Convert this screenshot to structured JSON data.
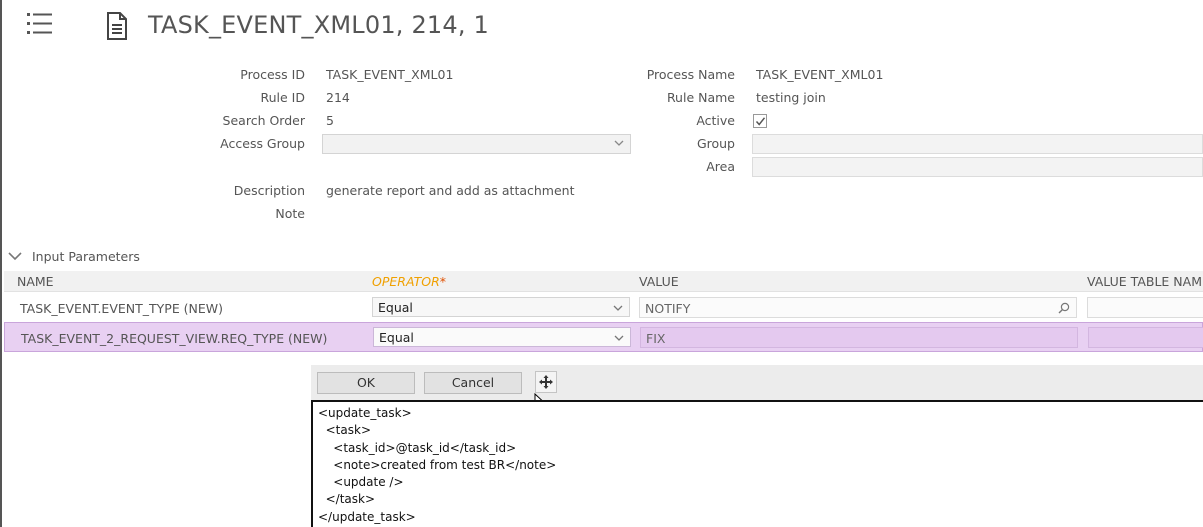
{
  "header": {
    "title": "TASK_EVENT_XML01,  214,  1"
  },
  "form": {
    "process_id_label": "Process ID",
    "process_id_value": "TASK_EVENT_XML01",
    "rule_id_label": "Rule ID",
    "rule_id_value": "214",
    "search_order_label": "Search Order",
    "search_order_value": "5",
    "access_group_label": "Access Group",
    "access_group_value": "",
    "description_label": "Description",
    "description_value": "generate report and add as attachment",
    "note_label": "Note",
    "note_value": "",
    "process_name_label": "Process Name",
    "process_name_value": "TASK_EVENT_XML01",
    "rule_name_label": "Rule Name",
    "rule_name_value": "testing join",
    "active_label": "Active",
    "active_checked": true,
    "group_label": "Group",
    "group_value": "",
    "area_label": "Area",
    "area_value": ""
  },
  "input_parameters": {
    "section_label": "Input Parameters",
    "columns": {
      "name": "NAME",
      "operator": "OPERATOR",
      "operator_required_mark": "*",
      "value": "VALUE",
      "value_table_name": "VALUE TABLE NAME"
    },
    "rows": [
      {
        "name": "TASK_EVENT.EVENT_TYPE (NEW)",
        "operator": "Equal",
        "value": "NOTIFY",
        "value_table": ""
      },
      {
        "name": "TASK_EVENT_2_REQUEST_VIEW.REQ_TYPE (NEW)",
        "operator": "Equal",
        "value": "FIX",
        "value_table": ""
      }
    ]
  },
  "popup": {
    "ok_label": "OK",
    "cancel_label": "Cancel",
    "xml_lines": [
      "<update_task>",
      "  <task>",
      "    <task_id>@task_id</task_id>",
      "    <note>created from test BR</note>",
      "    <update />",
      "  </task>",
      "</update_task>"
    ]
  },
  "colors": {
    "selected_row_bg": "#e8d0f2",
    "required_operator": "#f0a000"
  }
}
